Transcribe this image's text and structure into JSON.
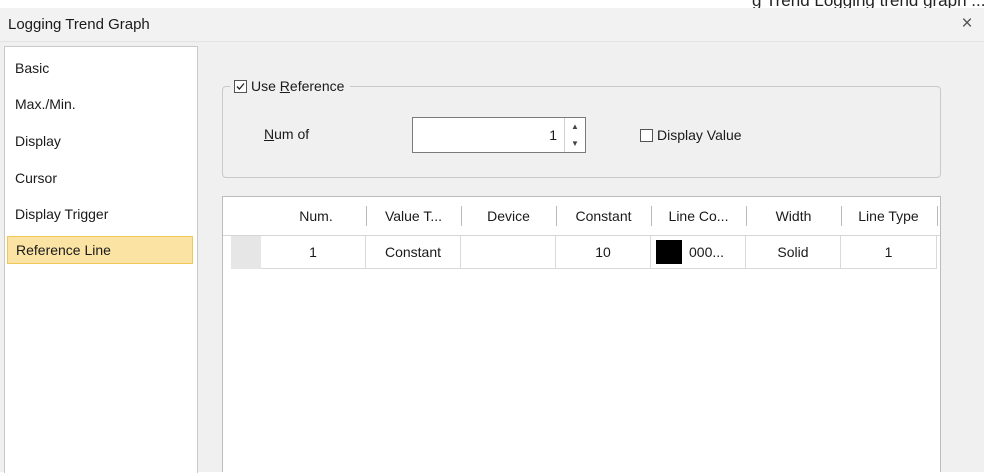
{
  "header_overflow_text": "g Trend Logging trend graph ...",
  "dialog": {
    "title": "Logging Trend Graph",
    "close_glyph": "×"
  },
  "nav": {
    "items": [
      {
        "label": "Basic",
        "selected": false
      },
      {
        "label": "Max./Min.",
        "selected": false
      },
      {
        "label": "Display",
        "selected": false
      },
      {
        "label": "Cursor",
        "selected": false
      },
      {
        "label": "Display Trigger",
        "selected": false
      },
      {
        "label": "Reference Line",
        "selected": true
      }
    ]
  },
  "reference": {
    "use_reference": {
      "label_prefix": "Use ",
      "label_mnemonic": "R",
      "label_suffix": "eference",
      "checked": true
    },
    "num_of": {
      "label_mnemonic": "N",
      "label_suffix": "um of",
      "value": "1"
    },
    "display_value": {
      "label": "Display Value",
      "checked": false
    }
  },
  "grid": {
    "columns": [
      "Num.",
      "Value T...",
      "Device",
      "Constant",
      "Line Co...",
      "Width",
      "Line Type"
    ],
    "rows": [
      {
        "num": "1",
        "value_type": "Constant",
        "device": "",
        "constant": "10",
        "line_color_swatch": "#000000",
        "line_color_text": "000...",
        "width": "Solid",
        "line_type": "1"
      }
    ]
  },
  "colors": {
    "selected_bg": "#fbe3a3",
    "selected_border": "#f0c75a",
    "dialog_bg": "#f0f0f0"
  }
}
